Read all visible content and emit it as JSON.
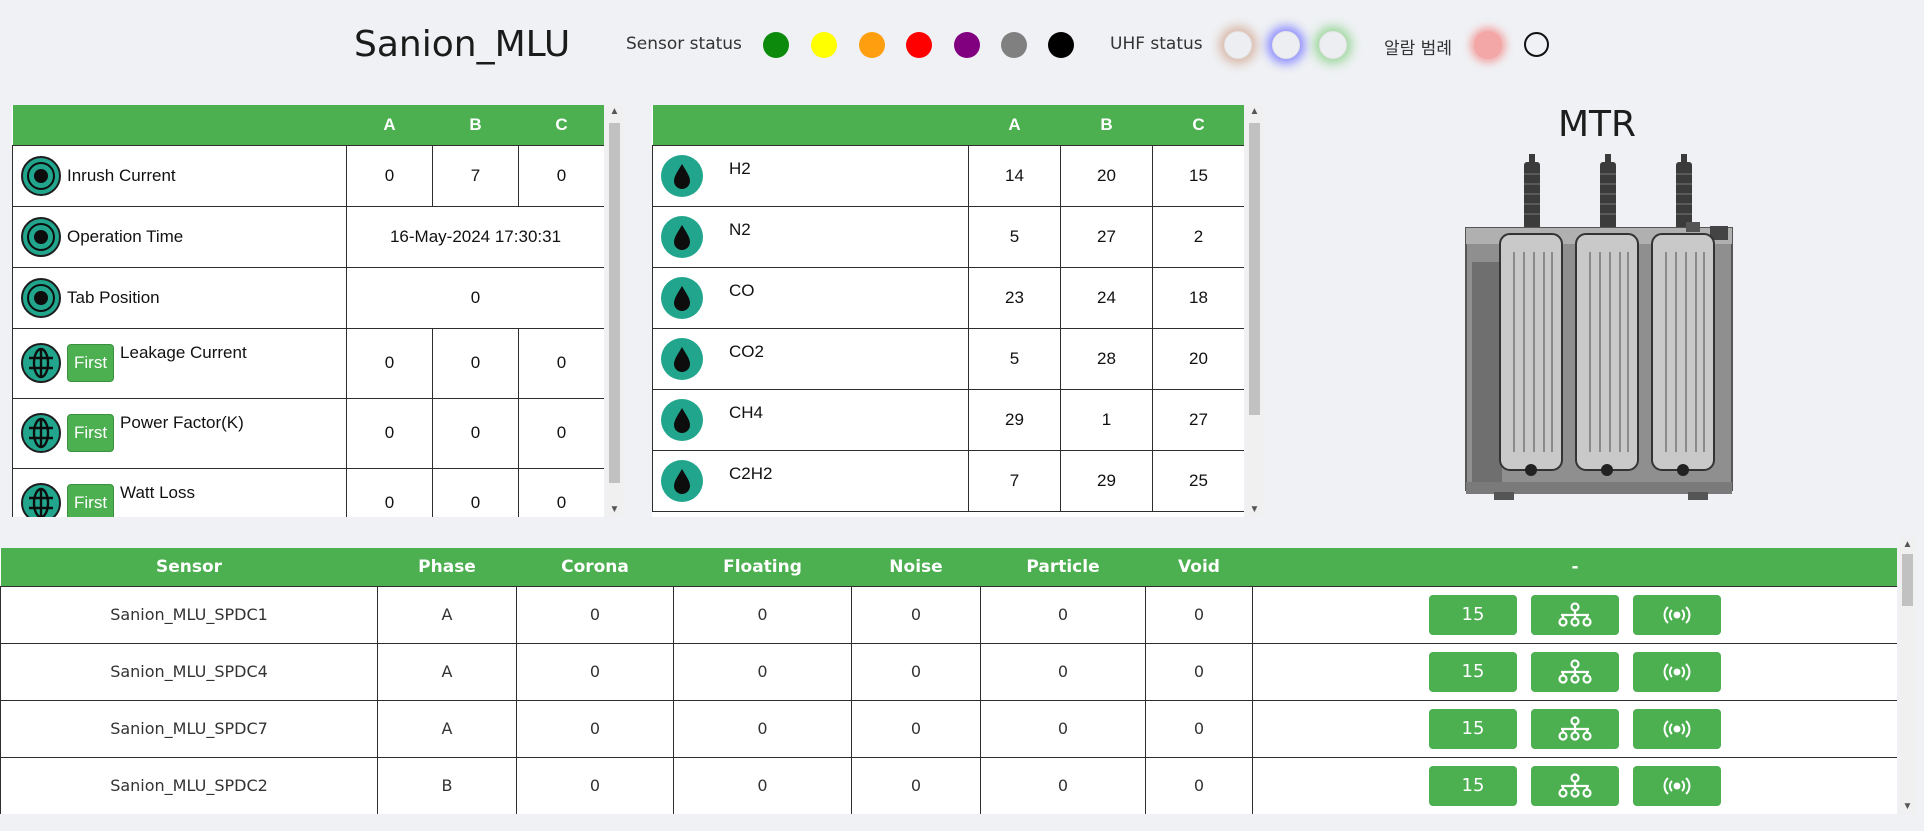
{
  "header": {
    "title": "Sanion_MLU",
    "sensor_status_label": "Sensor status",
    "sensor_status_colors": [
      "#0b8a0b",
      "#ffff00",
      "#ff9f10",
      "#ff0000",
      "#800080",
      "#808080",
      "#000000"
    ],
    "uhf_status_label": "UHF status",
    "uhf_glow_colors": [
      "#d9b8a8",
      "#8c8cff",
      "#9ed89e"
    ],
    "alarm_label": "알람 범례",
    "alarm_glow_color": "#f3a7a7"
  },
  "measurement_table": {
    "columns": [
      "",
      "A",
      "B",
      "C"
    ],
    "rows": [
      {
        "icon": "circle-target-icon",
        "label": "Inrush Current",
        "values": [
          "0",
          "7",
          "0"
        ]
      },
      {
        "icon": "circle-target-icon",
        "label": "Operation Time",
        "merged": "16-May-2024 17:30:31"
      },
      {
        "icon": "circle-target-icon",
        "label": "Tab Position",
        "merged": "0"
      },
      {
        "icon": "grid-globe-icon",
        "badge": "First",
        "label": "Leakage Current",
        "values": [
          "0",
          "0",
          "0"
        ]
      },
      {
        "icon": "grid-globe-icon",
        "badge": "First",
        "label": "Power Factor(K)",
        "values": [
          "0",
          "0",
          "0"
        ]
      },
      {
        "icon": "grid-globe-icon",
        "badge": "First",
        "label": "Watt Loss",
        "values": [
          "0",
          "0",
          "0"
        ]
      }
    ]
  },
  "gas_table": {
    "columns": [
      "",
      "A",
      "B",
      "C"
    ],
    "rows": [
      {
        "icon": "oil-drop-icon",
        "label": "H2",
        "values": [
          "14",
          "20",
          "15"
        ]
      },
      {
        "icon": "oil-drop-icon",
        "label": "N2",
        "values": [
          "5",
          "27",
          "2"
        ]
      },
      {
        "icon": "oil-drop-icon",
        "label": "CO",
        "values": [
          "23",
          "24",
          "18"
        ]
      },
      {
        "icon": "oil-drop-icon",
        "label": "CO2",
        "values": [
          "5",
          "28",
          "20"
        ]
      },
      {
        "icon": "oil-drop-icon",
        "label": "CH4",
        "values": [
          "29",
          "1",
          "27"
        ]
      },
      {
        "icon": "oil-drop-icon",
        "label": "C2H2",
        "values": [
          "7",
          "29",
          "25"
        ]
      }
    ]
  },
  "mtr": {
    "title": "MTR"
  },
  "sensor_table": {
    "columns": [
      "Sensor",
      "Phase",
      "Corona",
      "Floating",
      "Noise",
      "Particle",
      "Void",
      "-"
    ],
    "rows": [
      {
        "sensor": "Sanion_MLU_SPDC1",
        "phase": "A",
        "corona": "0",
        "floating": "0",
        "noise": "0",
        "particle": "0",
        "void": "0",
        "count": "15"
      },
      {
        "sensor": "Sanion_MLU_SPDC4",
        "phase": "A",
        "corona": "0",
        "floating": "0",
        "noise": "0",
        "particle": "0",
        "void": "0",
        "count": "15"
      },
      {
        "sensor": "Sanion_MLU_SPDC7",
        "phase": "A",
        "corona": "0",
        "floating": "0",
        "noise": "0",
        "particle": "0",
        "void": "0",
        "count": "15"
      },
      {
        "sensor": "Sanion_MLU_SPDC2",
        "phase": "B",
        "corona": "0",
        "floating": "0",
        "noise": "0",
        "particle": "0",
        "void": "0",
        "count": "15"
      }
    ]
  }
}
